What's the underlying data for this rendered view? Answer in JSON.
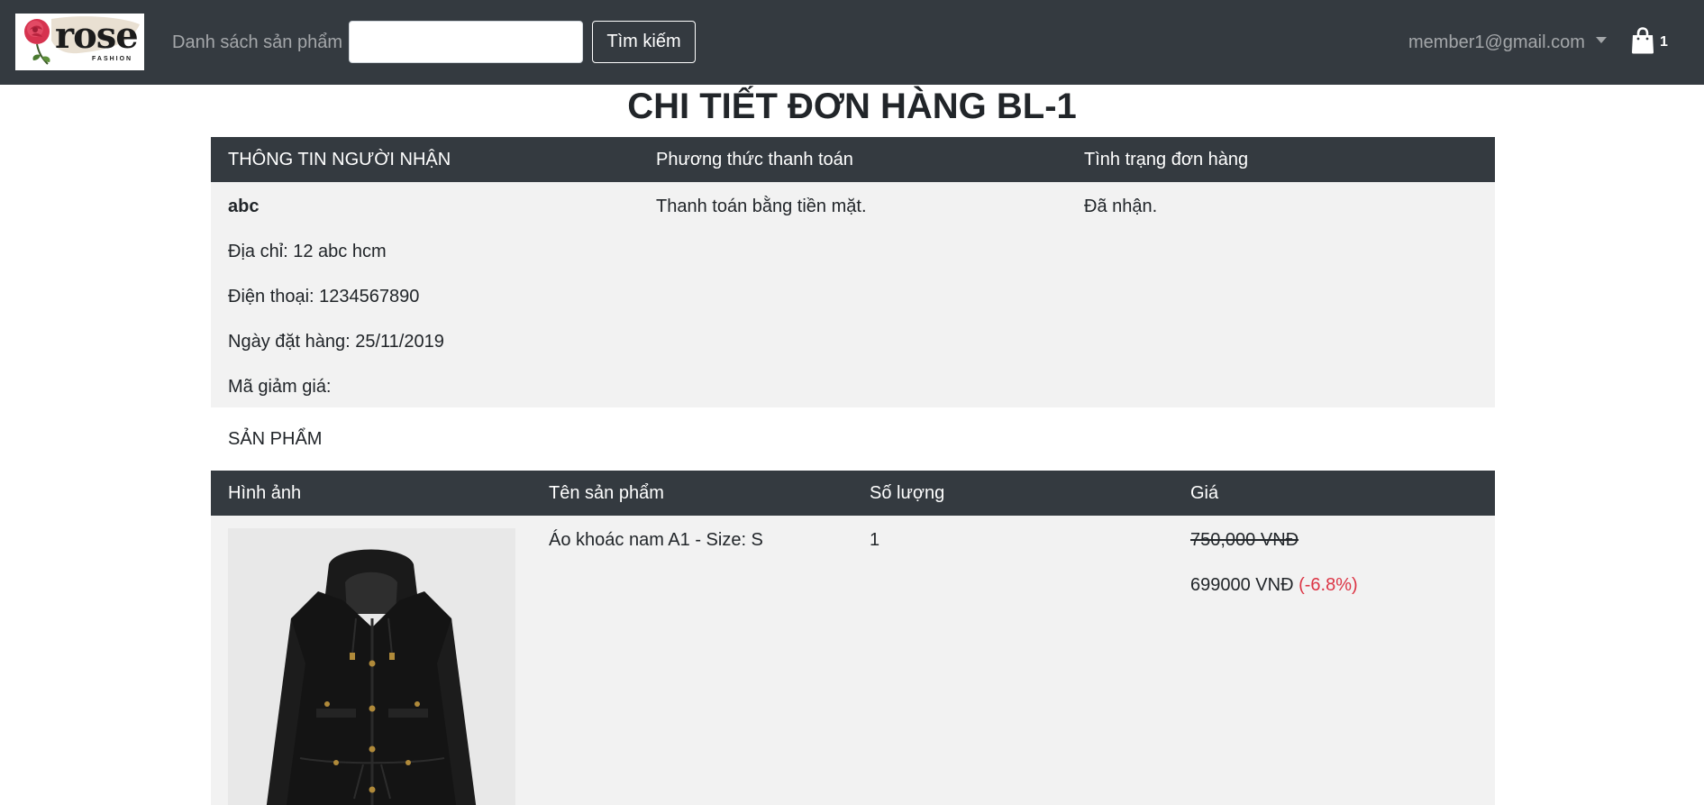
{
  "navbar": {
    "logo_text": "rose",
    "logo_sub": "FASHION",
    "nav_link": "Danh sách sản phẩm",
    "search_value": "",
    "search_button": "Tìm kiếm",
    "user_email": "member1@gmail.com",
    "cart_count": "1"
  },
  "page": {
    "title": "CHI TIẾT ĐƠN HÀNG BL-1"
  },
  "order_info": {
    "headers": [
      "THÔNG TIN NGƯỜI NHẬN",
      "Phương thức thanh toán",
      "Tình trạng đơn hàng"
    ],
    "recipient_name": "abc",
    "address": "Địa chỉ: 12 abc hcm",
    "phone": "Điện thoại: 1234567890",
    "order_date": "Ngày đặt hàng: 25/11/2019",
    "coupon": "Mã giảm giá:",
    "payment_method": "Thanh toán bằng tiền mặt.",
    "status": "Đã nhận."
  },
  "products": {
    "section_label": "SẢN PHẨM",
    "headers": [
      "Hình ảnh",
      "Tên sản phẩm",
      "Số lượng",
      "Giá"
    ],
    "items": [
      {
        "name": "Áo khoác nam A1 - Size: S",
        "quantity": "1",
        "original_price": "750,000 VNĐ",
        "price": "699000 VNĐ",
        "discount": "(-6.8%)"
      }
    ]
  },
  "colors": {
    "navbar_bg": "#343a40",
    "table_body_bg": "#f2f2f2",
    "discount_red": "#dc3545"
  }
}
